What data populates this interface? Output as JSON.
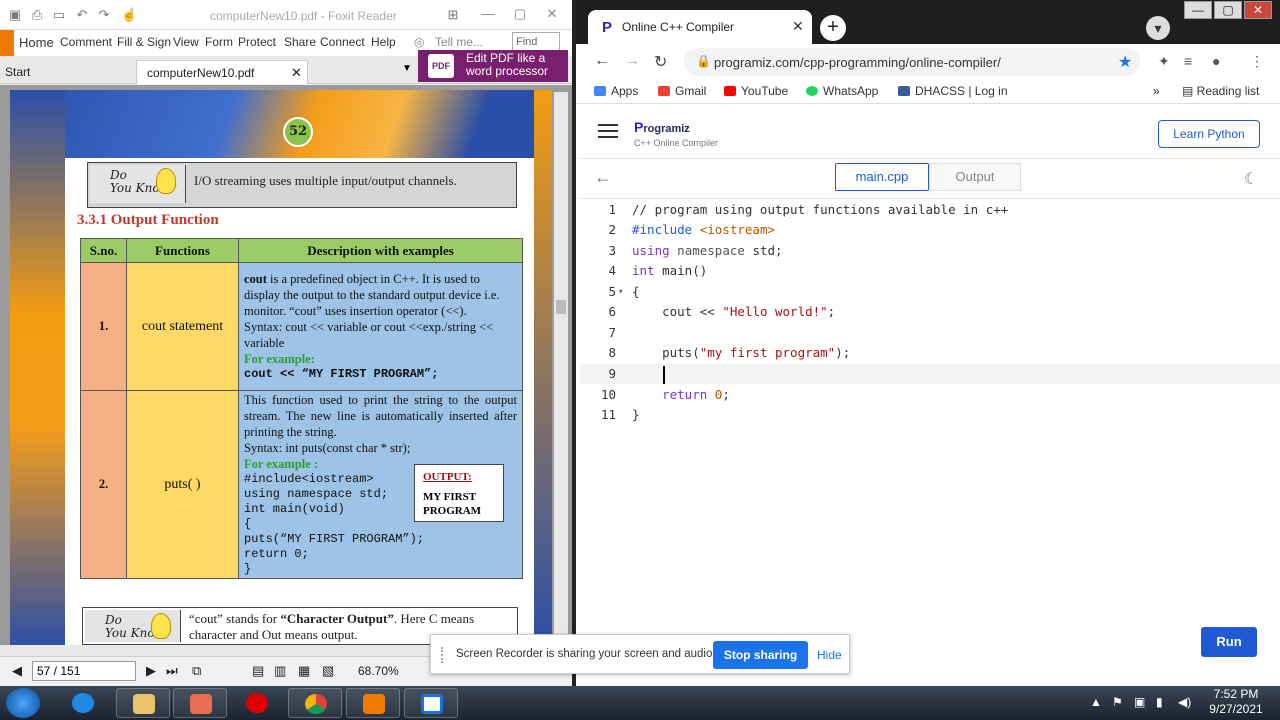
{
  "foxit": {
    "title": "computerNew10.pdf - Foxit Reader",
    "ribbon_tabs": [
      "Home",
      "Comment",
      "Fill & Sign",
      "View",
      "Form",
      "Protect",
      "Share",
      "Connect",
      "Help"
    ],
    "tell_me": "Tell me...",
    "find_placeholder": "Find",
    "start_tab": "Start",
    "doc_tab": "computerNew10.pdf",
    "ad_line1": "Edit PDF like a",
    "ad_line2": "word processor",
    "ad_icon": "PDF",
    "page_input": "57 / 151",
    "zoom": "68.70%"
  },
  "pdf": {
    "page_badge": "52",
    "dyk1_label1": "Do",
    "dyk1_label2": "You Know?",
    "dyk1_text": "I/O streaming uses multiple input/output channels.",
    "section_title": "3.3.1  Output Function",
    "table_headers": [
      "S.no.",
      "Functions",
      "Description with examples"
    ],
    "row1": {
      "sno": "1.",
      "func": "cout statement",
      "kw": "cout",
      "desc": " is a predefined object in C++. It is used to display the output to the standard output device i.e. monitor. “cout” uses insertion operator (<<).",
      "syntax": "Syntax: cout << variable  or  cout <<exp./string << variable",
      "example_label": "For example:",
      "example_code": "cout << “MY FIRST PROGRAM”;"
    },
    "row2": {
      "sno": "2.",
      "func": "puts( )",
      "desc": "This function used to print the string to the output stream. The new line is automatically inserted after printing the string.",
      "syntax": "Syntax:          int puts(const char * str);",
      "example_label": "For example :",
      "code": [
        "#include<iostream>",
        "using namespace std;",
        "int main(void)",
        "{",
        "puts(“MY FIRST PROGRAM”);",
        "return 0;",
        "}"
      ],
      "output_label": "OUTPUT:",
      "output_text": "MY FIRST PROGRAM"
    },
    "dyk2_label1": "Do",
    "dyk2_label2": "You Know?",
    "dyk2_text_a": "“cout” stands for ",
    "dyk2_text_b": "“Character Output”",
    "dyk2_text_c": ". Here C means",
    "dyk2_text_d": "character and Out means output."
  },
  "chrome": {
    "tab_title": "Online C++ Compiler",
    "url": "programiz.com/cpp-programming/online-compiler/",
    "bookmarks": [
      "Apps",
      "Gmail",
      "YouTube",
      "WhatsApp",
      "DHACSS | Log in"
    ],
    "reading_list": "Reading list",
    "bookmark_colors": {
      "apps": "#4285f4",
      "gmail": "#ea4335",
      "youtube": "#ff0000",
      "whatsapp": "#25d366",
      "dhacss": "#3a5a99"
    }
  },
  "programiz": {
    "logo": "rogramiz",
    "logo_p": "P",
    "subtitle": "C++ Online Compiler",
    "learn_button": "Learn Python",
    "tab_main": "main.cpp",
    "tab_output": "Output",
    "run_button": "Run"
  },
  "code_lines": {
    "l1": "// program using output functions available in c++",
    "l2a": "#include ",
    "l2b": "<iostream>",
    "l3a": "using",
    "l3b": " namespace ",
    "l3c": "std;",
    "l4a": "int",
    "l4b": " main()",
    "l5": "{",
    "l6a": "    cout << ",
    "l6b": "\"Hello world!\"",
    "l6c": ";",
    "l7": "",
    "l8a": "    puts(",
    "l8b": "\"my first program\"",
    "l8c": ");",
    "l9": "    ",
    "l10a": "    return ",
    "l10b": "0",
    "l10c": ";",
    "l11": "}"
  },
  "share_bar": {
    "text": "Screen Recorder is sharing your screen and audio.",
    "stop": "Stop sharing",
    "hide": "Hide"
  },
  "taskbar": {
    "time": "7:52 PM",
    "date": "9/27/2021"
  }
}
